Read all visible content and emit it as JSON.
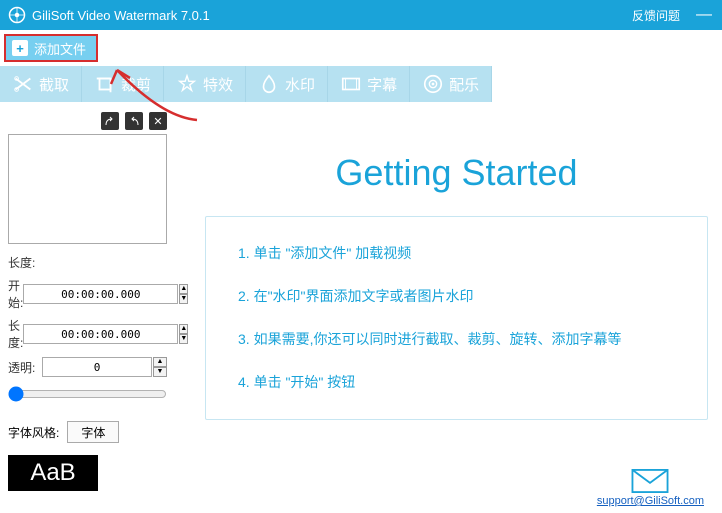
{
  "titlebar": {
    "app_name": "GiliSoft Video Watermark 7.0.1",
    "feedback": "反馈问题"
  },
  "toolbar": {
    "add_file": "添加文件"
  },
  "tabs": [
    {
      "label": "截取"
    },
    {
      "label": "裁剪"
    },
    {
      "label": "特效"
    },
    {
      "label": "水印"
    },
    {
      "label": "字幕"
    },
    {
      "label": "配乐"
    }
  ],
  "left": {
    "length_label": "长度:",
    "start_label": "开始:",
    "start_value": "00:00:00.000",
    "duration_label": "长度:",
    "duration_value": "00:00:00.000",
    "opacity_label": "透明:",
    "opacity_value": "0",
    "font_style_label": "字体风格:",
    "font_button": "字体",
    "sample_text": "AaB"
  },
  "getting_started": {
    "title": "Getting Started",
    "steps": [
      "1. 单击 \"添加文件\" 加载视频",
      "2. 在\"水印\"界面添加文字或者图片水印",
      "3. 如果需要,你还可以同时进行截取、裁剪、旋转、添加字幕等",
      "4. 单击 \"开始\" 按钮"
    ]
  },
  "support": {
    "email": "support@GiliSoft.com"
  }
}
